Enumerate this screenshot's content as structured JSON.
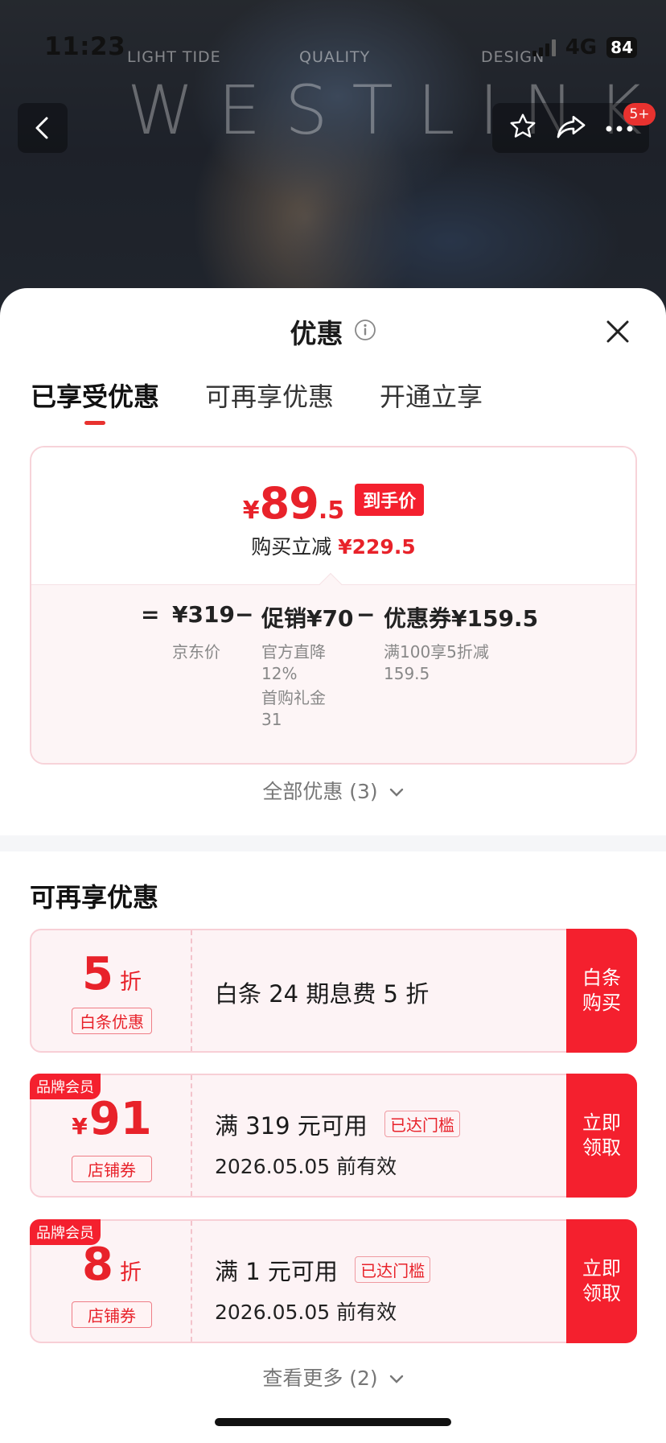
{
  "status_bar": {
    "time": "11:23",
    "network": "4G",
    "battery": "84"
  },
  "hero": {
    "watermark_left": "LIGHT TIDE",
    "watermark_mid": "QUALITY",
    "watermark_right": "DESIGN",
    "brand_watermark": "WESTLINK",
    "message_badge": "5+"
  },
  "sheet": {
    "title": "优惠",
    "tabs": [
      {
        "label": "已享受优惠",
        "active": true
      },
      {
        "label": "可再享优惠",
        "active": false
      },
      {
        "label": "开通立享",
        "active": false
      }
    ]
  },
  "summary": {
    "price_yen": "¥",
    "price_int": "89",
    "price_dec": ".5",
    "price_tag": "到手价",
    "saving_label": "购买立减",
    "saving_value": "¥229.5",
    "formula": {
      "eq": "=",
      "base": "¥319",
      "base_label": "京东价",
      "minus1": "−",
      "promo": "促销¥70",
      "promo_note1": "官方直降",
      "promo_note1_value": "12%",
      "promo_note2": "首购礼金",
      "promo_note2_value": "31",
      "minus2": "−",
      "coupon": "优惠券¥159.5",
      "coupon_note": "满100享5折减",
      "coupon_note_value": "159.5"
    },
    "all_discounts": "全部优惠 (3)"
  },
  "more_section": {
    "title": "可再享优惠",
    "coupons": [
      {
        "brand_tag": "",
        "prefix": "",
        "value": "5",
        "unit": "折",
        "type": "白条优惠",
        "title": "白条 24 期息费 5 折",
        "reached": "",
        "subtitle": "",
        "button": "白条\n购买"
      },
      {
        "brand_tag": "品牌会员",
        "prefix": "¥",
        "value": "91",
        "unit": "",
        "type": "店铺券",
        "title": "满 319 元可用",
        "reached": "已达门槛",
        "subtitle": "2026.05.05 前有效",
        "button": "立即\n领取"
      },
      {
        "brand_tag": "品牌会员",
        "prefix": "",
        "value": "8",
        "unit": "折",
        "type": "店铺券",
        "title": "满 1 元可用",
        "reached": "已达门槛",
        "subtitle": "2026.05.05 前有效",
        "button": "立即\n领取"
      }
    ],
    "see_more": "查看更多 (2)"
  },
  "colors": {
    "accent": "#f4202e",
    "price_red": "#e8222a",
    "card_bg": "#fdf3f5"
  },
  "icons": [
    "back-icon",
    "star-icon",
    "share-icon",
    "more-icon",
    "info-icon",
    "close-icon",
    "chevron-down-icon"
  ]
}
